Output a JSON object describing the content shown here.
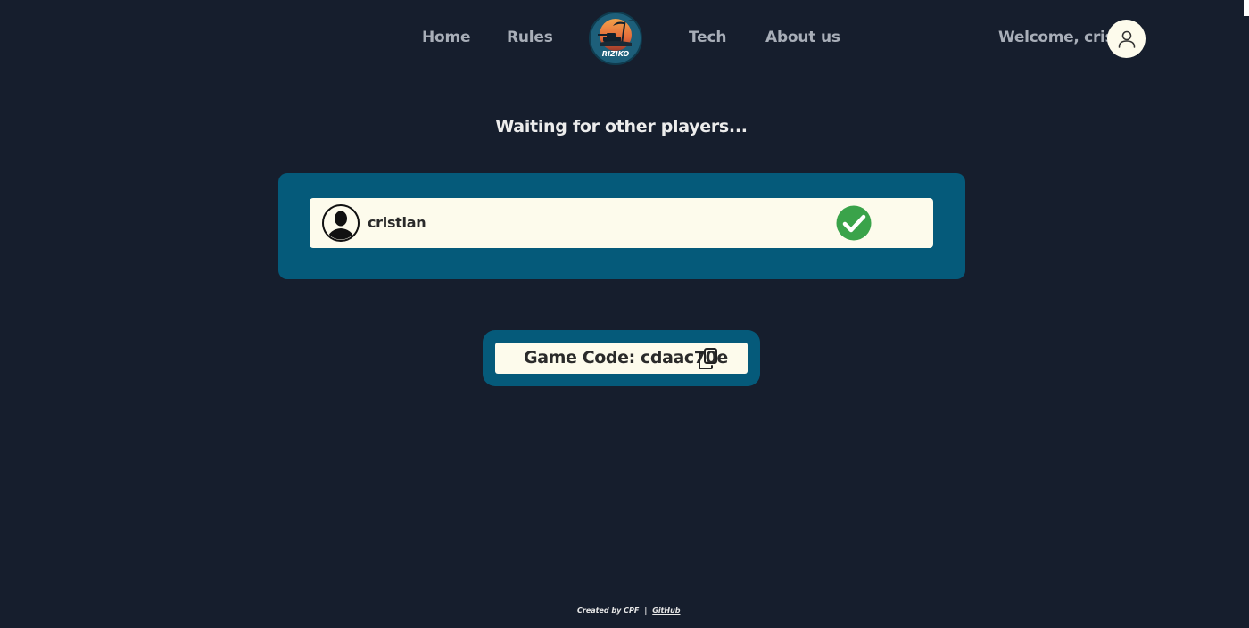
{
  "nav": {
    "home": "Home",
    "rules": "Rules",
    "tech": "Tech",
    "about": "About us",
    "logo_text": "RIZIKO"
  },
  "header": {
    "welcome": "Welcome, cristi..."
  },
  "lobby": {
    "waiting_text": "Waiting for other players...",
    "players": [
      {
        "name": "cristian",
        "ready": true
      }
    ],
    "game_code_label": "Game Code: cdaac70e"
  },
  "footer": {
    "created_by": "Created by CPF",
    "separator": "|",
    "github": "GitHub"
  },
  "colors": {
    "background": "#161e2d",
    "panel": "#055a7a",
    "card": "#fdfbec",
    "ready_green": "#3aa34a",
    "nav_text": "#a8aeb8"
  }
}
